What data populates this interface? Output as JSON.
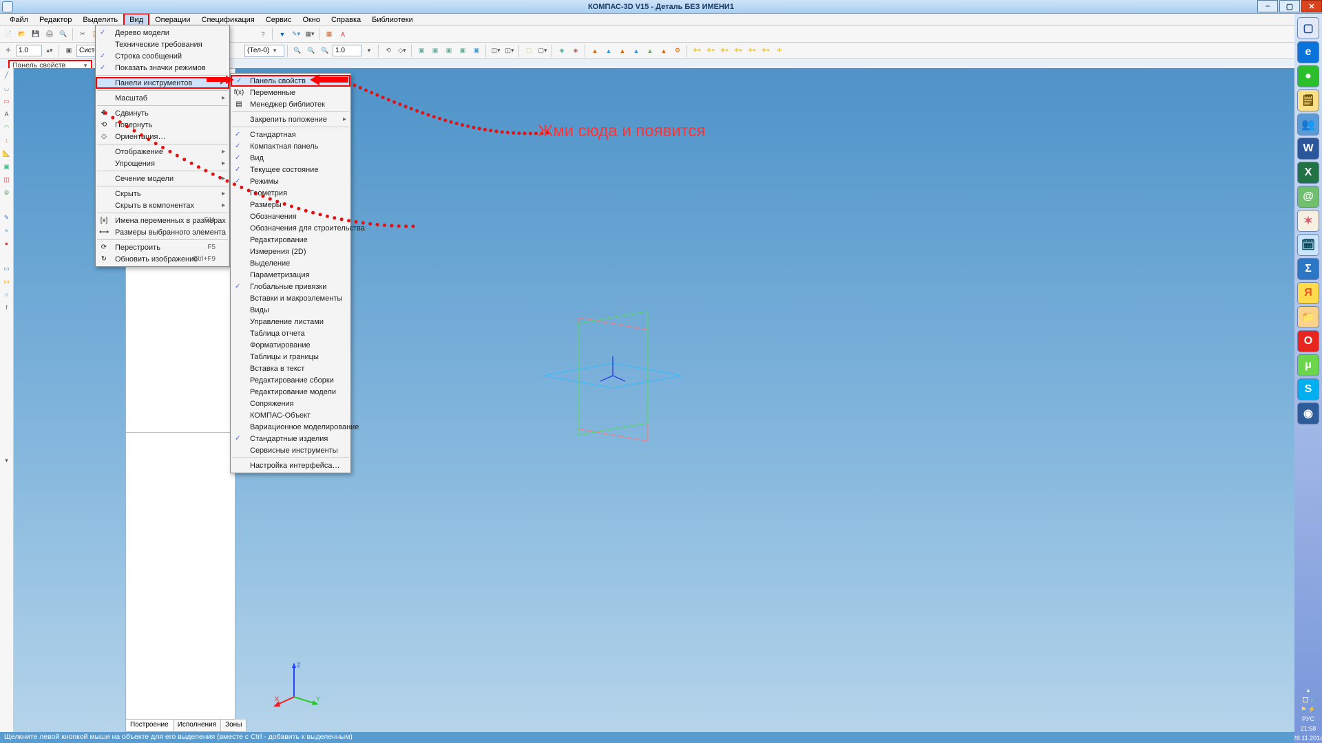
{
  "window": {
    "title": "КОМПАС-3D V15 - Деталь БЕЗ ИМЕНИ1"
  },
  "menubar": {
    "items": [
      "Файл",
      "Редактор",
      "Выделить",
      "Вид",
      "Операции",
      "Спецификация",
      "Сервис",
      "Окно",
      "Справка",
      "Библиотеки"
    ]
  },
  "toolbar1": {
    "scale_input": "1.0",
    "combo": "(Тел-0)"
  },
  "toolbar2": {
    "zoom": "1.0",
    "combo1": "Систе"
  },
  "propbar": {
    "label": "Панель свойств"
  },
  "view_menu": {
    "items": [
      {
        "label": "Дерево модели",
        "chk": true
      },
      {
        "label": "Технические требования"
      },
      {
        "label": "Строка сообщений",
        "chk": true
      },
      {
        "label": "Показать значки режимов",
        "chk": true
      },
      {
        "sep": true
      },
      {
        "label": "Панели инструментов",
        "hl": true,
        "sub": true
      },
      {
        "sep": true
      },
      {
        "label": "Масштаб",
        "sub": true
      },
      {
        "sep": true
      },
      {
        "label": "Сдвинуть",
        "icon": "move"
      },
      {
        "label": "Повернуть",
        "icon": "rotate"
      },
      {
        "label": "Ориентация…",
        "icon": "orient"
      },
      {
        "sep": true
      },
      {
        "label": "Отображение",
        "sub": true
      },
      {
        "label": "Упрощения",
        "sub": true
      },
      {
        "sep": true
      },
      {
        "label": "Сечение модели",
        "sub": true
      },
      {
        "sep": true
      },
      {
        "label": "Скрыть",
        "sub": true
      },
      {
        "label": "Скрыть в компонентах",
        "sub": true
      },
      {
        "sep": true
      },
      {
        "label": "Имена переменных в размерах",
        "icon": "vari",
        "shortcut": "F11"
      },
      {
        "label": "Размеры выбранного элемента",
        "icon": "dim"
      },
      {
        "sep": true
      },
      {
        "label": "Перестроить",
        "icon": "rebuild",
        "shortcut": "F5"
      },
      {
        "label": "Обновить изображение",
        "icon": "refresh",
        "shortcut": "Ctrl+F9"
      }
    ]
  },
  "sub_menu": {
    "items": [
      {
        "label": "Панель свойств",
        "chk": true,
        "hl": true
      },
      {
        "label": "Переменные",
        "icon": "fx"
      },
      {
        "label": "Менеджер библиотек",
        "icon": "lib"
      },
      {
        "sep": true
      },
      {
        "label": "Закрепить положение",
        "sub": true
      },
      {
        "sep": true
      },
      {
        "label": "Стандартная",
        "chk": true
      },
      {
        "label": "Компактная панель",
        "chk": true
      },
      {
        "label": "Вид",
        "chk": true
      },
      {
        "label": "Текущее состояние",
        "chk": true
      },
      {
        "label": "Режимы",
        "chk": true
      },
      {
        "label": "Геометрия"
      },
      {
        "label": "Размеры"
      },
      {
        "label": "Обозначения"
      },
      {
        "label": "Обозначения для строительства"
      },
      {
        "label": "Редактирование"
      },
      {
        "label": "Измерения (2D)"
      },
      {
        "label": "Выделение"
      },
      {
        "label": "Параметризация"
      },
      {
        "label": "Глобальные привязки",
        "chk": true
      },
      {
        "label": "Вставки и макроэлементы"
      },
      {
        "label": "Виды"
      },
      {
        "label": "Управление листами"
      },
      {
        "label": "Таблица отчета"
      },
      {
        "label": "Форматирование"
      },
      {
        "label": "Таблицы и границы"
      },
      {
        "label": "Вставка в текст"
      },
      {
        "label": "Редактирование сборки"
      },
      {
        "label": "Редактирование модели"
      },
      {
        "label": "Сопряжения"
      },
      {
        "label": "КОМПАС-Объект"
      },
      {
        "label": "Вариационное моделирование"
      },
      {
        "label": "Стандартные изделия",
        "chk": true
      },
      {
        "label": "Сервисные инструменты"
      },
      {
        "sep": true
      },
      {
        "label": "Настройка интерфейса…"
      }
    ]
  },
  "tree": {
    "tabs": [
      "Построение",
      "Исполнения",
      "Зоны"
    ]
  },
  "annot": {
    "text": "Жми сюда и появится"
  },
  "status": {
    "text": "Щелкните левой кнопкой мыши на объекте для его выделения (вместе с Ctrl - добавить к выделенным)"
  },
  "clock": {
    "time": "21:58",
    "date": "28.11.2014",
    "lang": "РУС"
  },
  "sidebar_apps": [
    {
      "bg": "#e1e9f8",
      "fg": "#1e4fa1",
      "ch": "▢"
    },
    {
      "bg": "#0a74da",
      "fg": "#fff",
      "ch": "e"
    },
    {
      "bg": "#2bbf2b",
      "fg": "#fff",
      "ch": "●"
    },
    {
      "bg": "#f9e089",
      "fg": "#6b4a00",
      "ch": "🗒"
    },
    {
      "bg": "#5b9bd5",
      "fg": "#fff",
      "ch": "👥"
    },
    {
      "bg": "#2b579a",
      "fg": "#fff",
      "ch": "W"
    },
    {
      "bg": "#217346",
      "fg": "#fff",
      "ch": "X"
    },
    {
      "bg": "#6fbf6f",
      "fg": "#fff",
      "ch": "@"
    },
    {
      "bg": "#f5f0e1",
      "fg": "#d56",
      "ch": "✶"
    },
    {
      "bg": "#cce5ff",
      "fg": "#045",
      "ch": "🗓"
    },
    {
      "bg": "#2b77c6",
      "fg": "#fff",
      "ch": "Σ"
    },
    {
      "bg": "#ffdb4d",
      "fg": "#e52",
      "ch": "Я"
    },
    {
      "bg": "#f9d38c",
      "fg": "#845",
      "ch": "📁"
    },
    {
      "bg": "#e8251f",
      "fg": "#fff",
      "ch": "O"
    },
    {
      "bg": "#6bd64b",
      "fg": "#fff",
      "ch": "μ"
    },
    {
      "bg": "#00aff0",
      "fg": "#fff",
      "ch": "S"
    },
    {
      "bg": "#2e5c9a",
      "fg": "#fff",
      "ch": "◉"
    }
  ]
}
